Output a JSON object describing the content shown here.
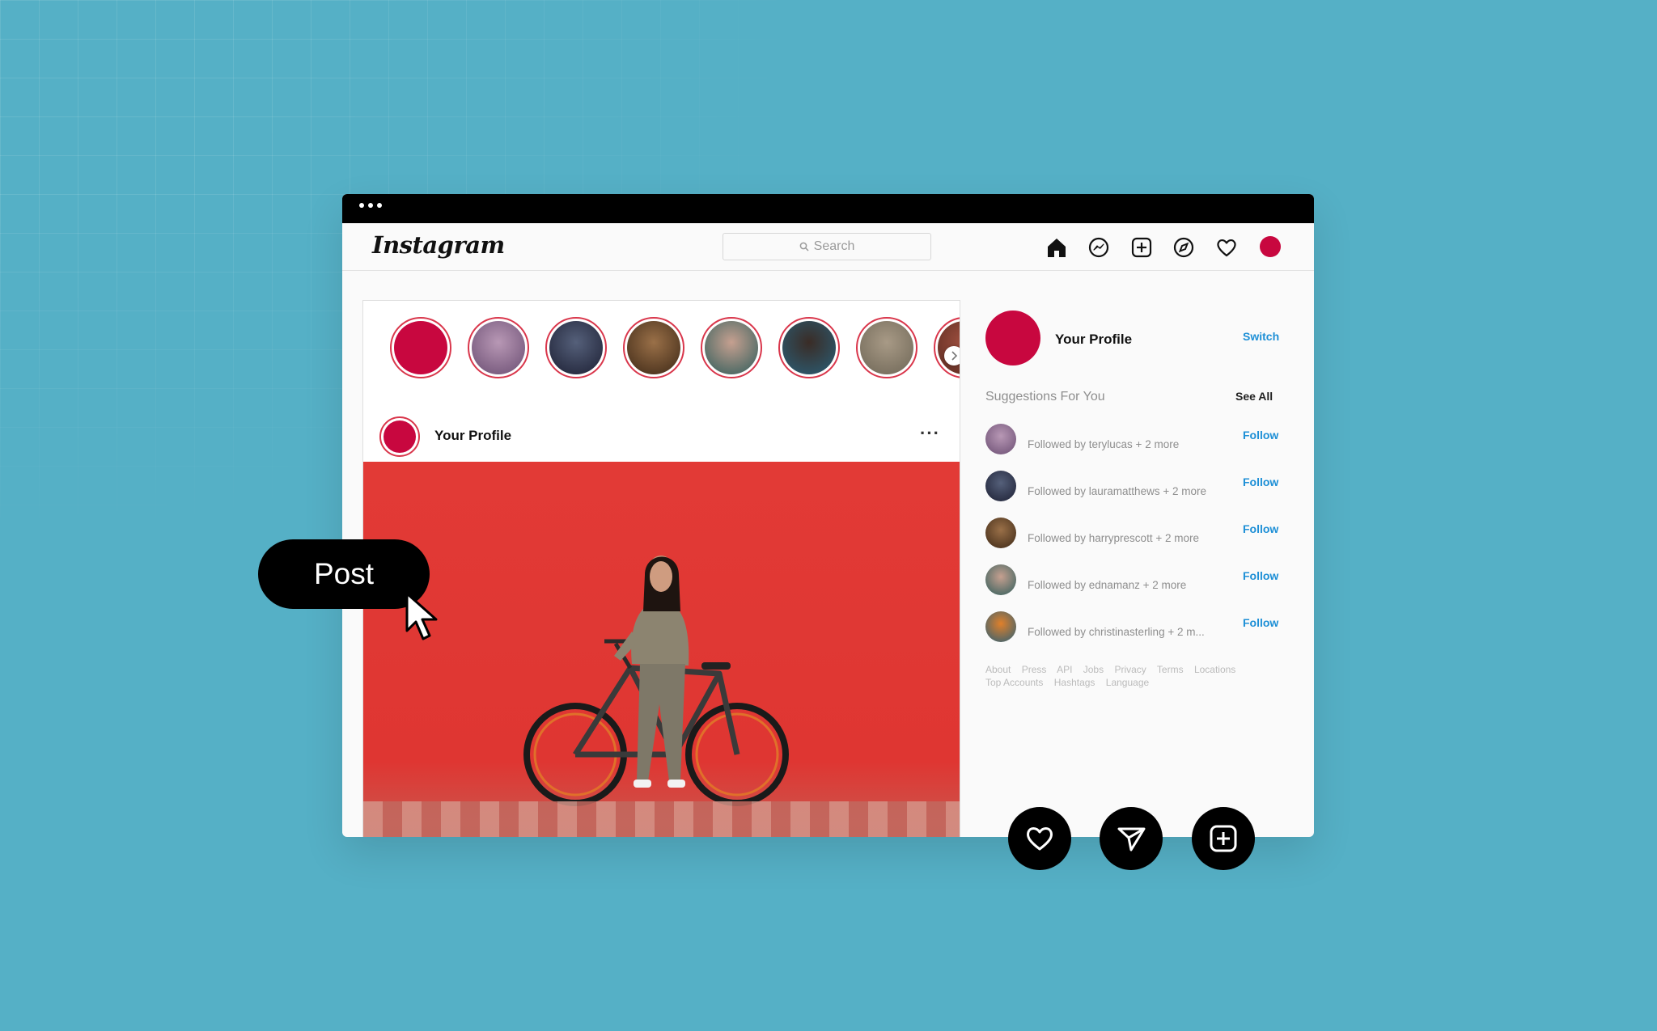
{
  "window": {
    "logo": "Instagram",
    "search_placeholder": "Search"
  },
  "nav_icons": [
    "home-icon",
    "messenger-icon",
    "new-post-icon",
    "explore-icon",
    "activity-heart-icon",
    "profile-avatar"
  ],
  "stories": {
    "colors": [
      "#c8073f",
      "#8a6b8f",
      "#2e3148",
      "#5a3b22",
      "#3f6b66",
      "#1f2a33",
      "#8d8270",
      "#7a3b30"
    ]
  },
  "post": {
    "author": "Your Profile",
    "more_label": "···"
  },
  "sidebar": {
    "profile_name": "Your Profile",
    "switch_label": "Switch",
    "suggestions_title": "Suggestions For You",
    "see_all_label": "See All",
    "suggestions": [
      {
        "text": "Followed by terylucas + 2 more",
        "follow": "Follow",
        "color": "#8a5a8f"
      },
      {
        "text": "Followed by lauramatthews + 2 more",
        "follow": "Follow",
        "color": "#2a2c45"
      },
      {
        "text": "Followed by harryprescott + 2 more",
        "follow": "Follow",
        "color": "#5a3b22"
      },
      {
        "text": "Followed by ednamanz + 2 more",
        "follow": "Follow",
        "color": "#3f6b66"
      },
      {
        "text": "Followed by christinasterling + 2 m...",
        "follow": "Follow",
        "color": "#2e5a70"
      }
    ],
    "footer_line1": [
      "About",
      "Press",
      "API",
      "Jobs",
      "Privacy",
      "Terms",
      "Locations"
    ],
    "footer_line2": [
      "Top Accounts",
      "Hashtags",
      "Language"
    ]
  },
  "overlay": {
    "post_button": "Post"
  },
  "fab_icons": [
    "heart-icon",
    "send-icon",
    "add-icon"
  ],
  "colors": {
    "background": "#55b0c6",
    "brand_red": "#c8073f",
    "link_blue": "#1d8fd6"
  }
}
